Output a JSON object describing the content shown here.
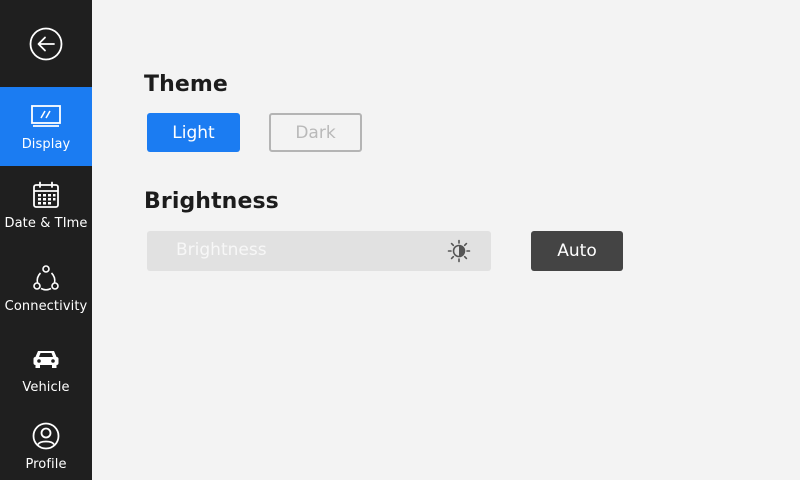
{
  "sidebar": {
    "back_icon": "arrow-left-circle-icon",
    "items": [
      {
        "label": "Display",
        "icon": "display-icon",
        "active": true
      },
      {
        "label": "Date & TIme",
        "icon": "calendar-icon",
        "active": false
      },
      {
        "label": "Connectivity",
        "icon": "connectivity-icon",
        "active": false
      },
      {
        "label": "Vehicle",
        "icon": "car-icon",
        "active": false
      },
      {
        "label": "Profile",
        "icon": "profile-icon",
        "active": false
      }
    ]
  },
  "theme": {
    "title": "Theme",
    "light_label": "Light",
    "dark_label": "Dark",
    "selected": "Light"
  },
  "brightness": {
    "title": "Brightness",
    "slider_label": "Brightness",
    "slider_icon": "brightness-sun-icon",
    "auto_label": "Auto"
  },
  "colors": {
    "accent": "#1b7cf2",
    "sidebar_bg": "#1f1f1f",
    "page_bg": "#f3f3f3"
  }
}
